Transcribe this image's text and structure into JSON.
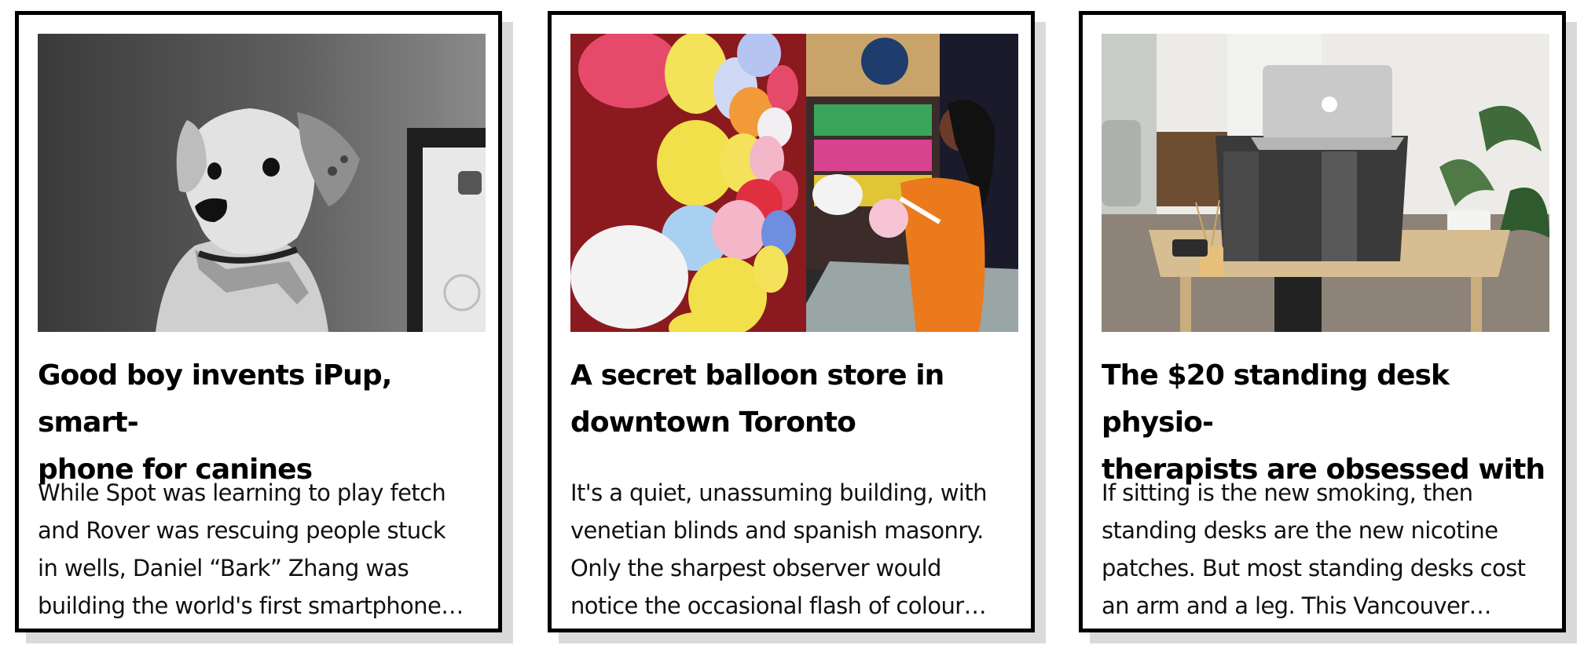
{
  "cards": [
    {
      "image_alt": "Black and white photo of a dog",
      "title": "Good boy invents iPup, smart-\nphone for canines",
      "excerpt": "While Spot was learning to play fetch\nand Rover was rescuing people stuck\nin wells, Daniel “Bark” Zhang was\nbuilding the world's first smartphone…"
    },
    {
      "image_alt": "Woman inflating balloons in front of a wall of colourful balloons",
      "title": "A secret balloon store in\ndowntown Toronto",
      "excerpt": "It's a quiet, unassuming building, with\nvenetian blinds and spanish masonry.\nOnly the sharpest observer would\nnotice the occasional flash of colour…"
    },
    {
      "image_alt": "Laptop on a cardboard standing desk on a wooden table",
      "title": "The $20 standing desk physio-\ntherapists are obsessed with",
      "excerpt": "If sitting is the new smoking, then\nstanding desks are the new nicotine\npatches. But most standing desks cost\nan arm and a leg. This Vancouver…"
    }
  ],
  "colors": {
    "border": "#000000",
    "shadow": "#dadada",
    "text": "#111111"
  }
}
